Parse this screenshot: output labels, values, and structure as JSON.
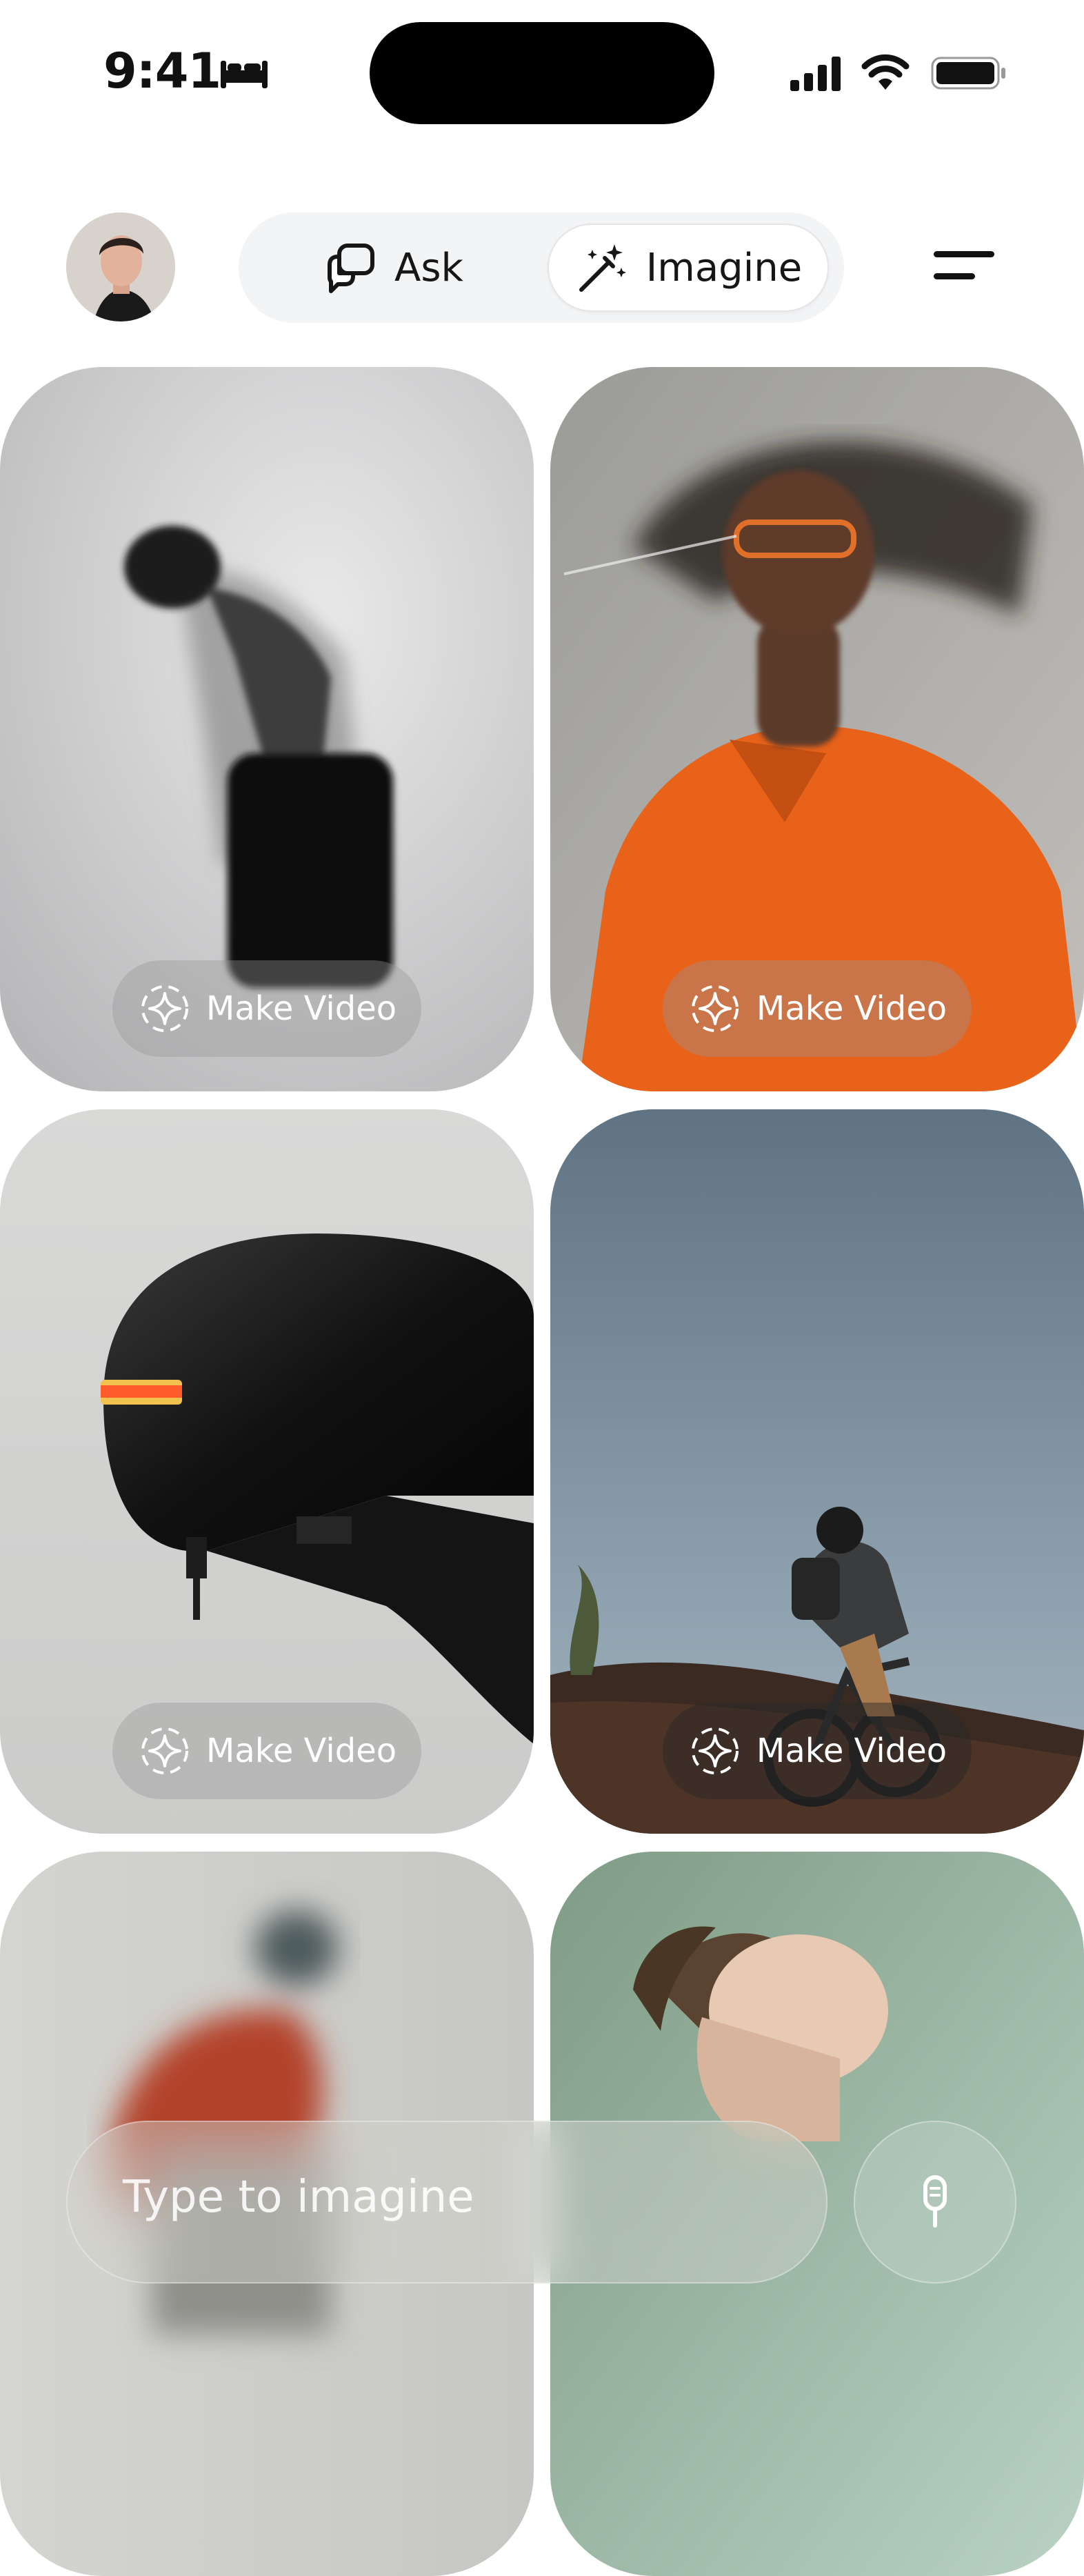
{
  "status_bar": {
    "time": "9:41",
    "icons": [
      "bed-icon",
      "signal-icon",
      "wifi-icon",
      "battery-icon"
    ]
  },
  "header": {
    "avatar": "profile-avatar",
    "tabs": [
      {
        "label": "Ask",
        "icon": "chat-bubbles-icon",
        "selected": false
      },
      {
        "label": "Imagine",
        "icon": "magic-wand-icon",
        "selected": true
      }
    ],
    "menu_icon": "menu-icon"
  },
  "gallery": {
    "cards": [
      {
        "subject": "blurred-dancer",
        "action_label": "Make Video",
        "button_icon": "sparkle-icon"
      },
      {
        "subject": "man-orange-shirt",
        "action_label": "Make Video",
        "button_icon": "sparkle-icon"
      },
      {
        "subject": "black-helmet-robot",
        "action_label": "Make Video",
        "button_icon": "sparkle-icon"
      },
      {
        "subject": "mountain-biker",
        "action_label": "Make Video",
        "button_icon": "sparkle-icon"
      },
      {
        "subject": "blurred-runner",
        "action_label": "",
        "button_icon": ""
      },
      {
        "subject": "curly-hair-portrait",
        "action_label": "",
        "button_icon": ""
      }
    ]
  },
  "composer": {
    "placeholder": "Type to imagine",
    "mic_icon": "microphone-icon"
  },
  "colors": {
    "accent_orange": "#e8621a",
    "segment_bg": "#f3f4f5",
    "text_primary": "#161616"
  }
}
